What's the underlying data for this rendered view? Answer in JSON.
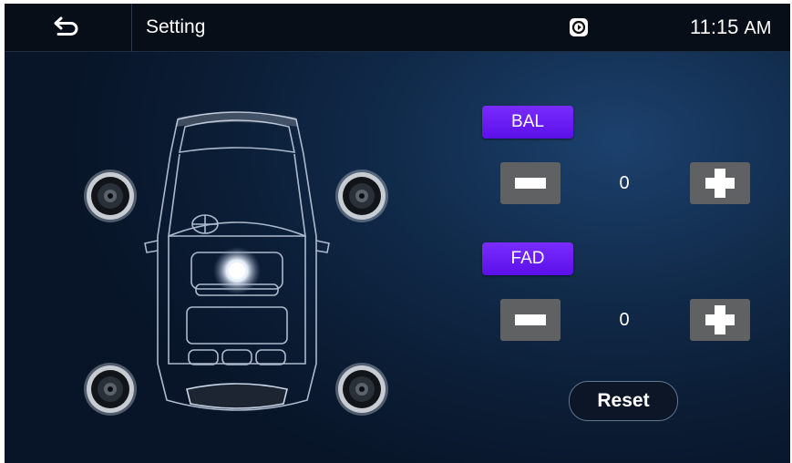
{
  "header": {
    "title": "Setting",
    "back_icon": "back-arrow-icon",
    "carplay_icon": "carplay-icon",
    "time": "11:15",
    "ampm": "AM"
  },
  "car_diagram": {
    "icon": "car-top-view-icon",
    "speakers": [
      "front-left",
      "front-right",
      "rear-left",
      "rear-right",
      "center-focus"
    ]
  },
  "balance": {
    "label": "BAL",
    "value": "0",
    "minus_icon": "minus-icon",
    "plus_icon": "plus-icon"
  },
  "fader": {
    "label": "FAD",
    "value": "0",
    "minus_icon": "minus-icon",
    "plus_icon": "plus-icon"
  },
  "reset_label": "Reset",
  "colors": {
    "tag_purple": "#6a1cf5",
    "step_gray": "#5f6163",
    "background_navy": "#0b1c34"
  }
}
